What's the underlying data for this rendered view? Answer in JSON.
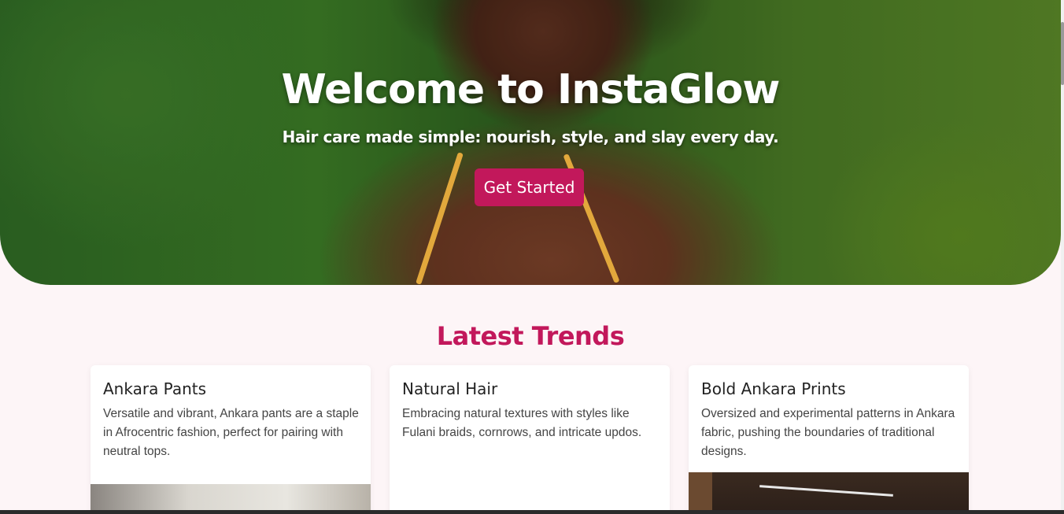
{
  "hero": {
    "title": "Welcome to InstaGlow",
    "subtitle": "Hair care made simple: nourish, style, and slay every day.",
    "cta_label": "Get Started"
  },
  "trends": {
    "heading": "Latest Trends",
    "cards": [
      {
        "title": "Ankara Pants",
        "description": "Versatile and vibrant, Ankara pants are a staple in Afrocentric fashion, perfect for pairing with neutral tops."
      },
      {
        "title": "Natural Hair",
        "description": "Embracing natural textures with styles like Fulani braids, cornrows, and intricate updos."
      },
      {
        "title": "Bold Ankara Prints",
        "description": "Oversized and experimental patterns in Ankara fabric, pushing the boundaries of traditional designs."
      }
    ]
  },
  "colors": {
    "accent": "#c2185b",
    "page_background": "#fdf5f7",
    "card_background": "#ffffff"
  }
}
